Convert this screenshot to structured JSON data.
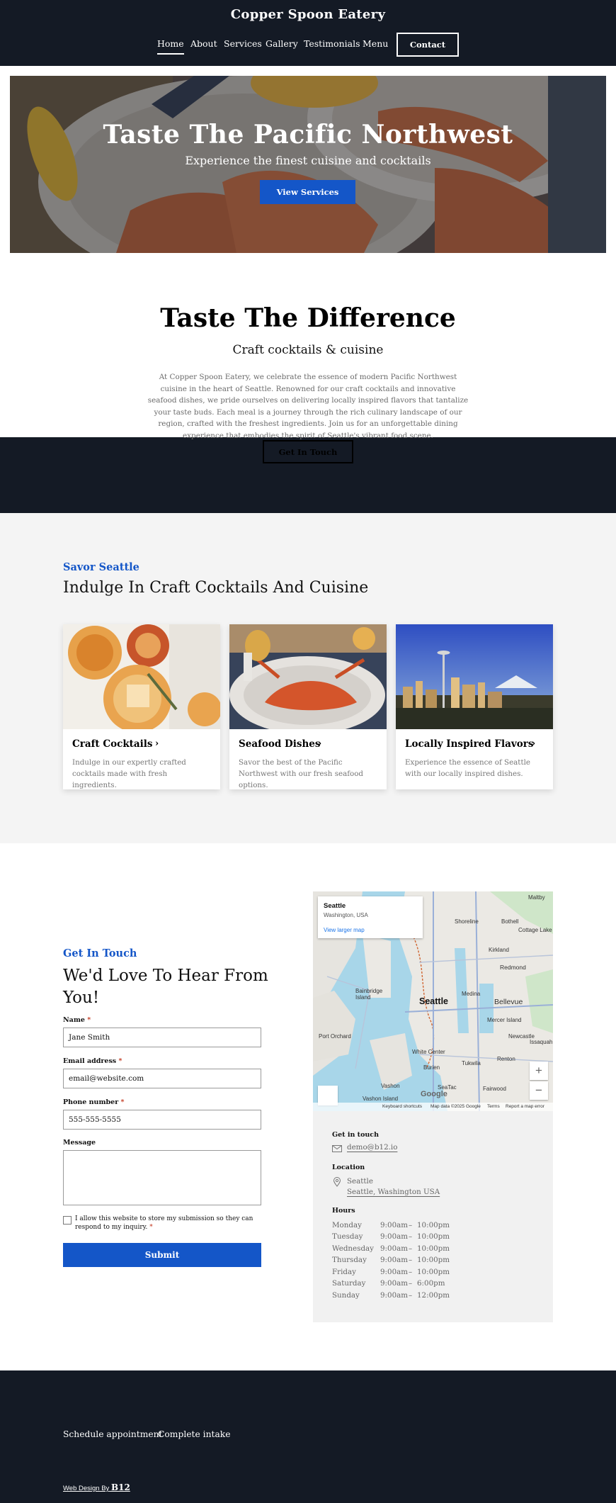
{
  "header": {
    "brand": "Copper Spoon Eatery",
    "nav": [
      "Home",
      "About",
      "Services",
      "Gallery",
      "Testimonials",
      "Menu"
    ],
    "active": "Home",
    "contact_label": "Contact"
  },
  "hero": {
    "title": "Taste The Pacific Northwest",
    "subtitle": "Experience the finest cuisine and cocktails",
    "button": "View Services"
  },
  "intro": {
    "title": "Taste The Difference",
    "subtitle": "Craft cocktails & cuisine",
    "body": "At Copper Spoon Eatery, we celebrate the essence of modern Pacific Northwest cuisine in the heart of Seattle. Renowned for our craft cocktails and innovative seafood dishes, we pride ourselves on delivering locally inspired flavors that tantalize your taste buds. Each meal is a journey through the rich culinary landscape of our region, crafted with the freshest ingredients. Join us for an unforgettable dining experience that embodies the spirit of Seattle's vibrant food scene.",
    "button": "Get In Touch"
  },
  "services": {
    "eyebrow": "Savor Seattle",
    "title": "Indulge In Craft Cocktails And Cuisine",
    "cards": [
      {
        "title": "Craft Cocktails",
        "text": "Indulge in our expertly crafted cocktails made with fresh ingredients."
      },
      {
        "title": "Seafood Dishes",
        "text": "Savor the best of the Pacific Northwest with our fresh seafood options."
      },
      {
        "title": "Locally Inspired Flavors",
        "text": "Experience the essence of Seattle with our locally inspired dishes."
      }
    ]
  },
  "contact": {
    "eyebrow": "Get In Touch",
    "title": "We'd Love To Hear From You!",
    "fields": {
      "name_label": "Name",
      "name_value": "Jane Smith",
      "email_label": "Email address",
      "email_value": "email@website.com",
      "phone_label": "Phone number",
      "phone_value": "555-555-5555",
      "message_label": "Message"
    },
    "required_mark": "*",
    "consent": "I allow this website to store my submission so they can respond to my inquiry.",
    "submit": "Submit"
  },
  "map": {
    "city": "Seattle",
    "region": "Washington, USA",
    "larger_map": "View larger map",
    "labels": [
      "Shoreline",
      "Bothell",
      "Cottage Lake",
      "Kirkland",
      "Redmond",
      "Bainbridge Island",
      "Seattle",
      "Medina",
      "Bellevue",
      "Mercer Island",
      "Port Orchard",
      "Newcastle",
      "White Center",
      "Burien",
      "Tukwila",
      "Renton",
      "Vashon",
      "SeaTac",
      "Fairwood",
      "Maltby",
      "Issaquah",
      "Vashon Island"
    ],
    "zoom_in": "+",
    "zoom_out": "−",
    "google": "Google",
    "footer": [
      "Keyboard shortcuts",
      "Map data ©2025 Google",
      "Terms",
      "Report a map error"
    ]
  },
  "info": {
    "get_in_touch_label": "Get in touch",
    "email": "demo@b12.io",
    "location_label": "Location",
    "location_line1": "Seattle",
    "location_line2": "Seattle, Washington USA",
    "hours_label": "Hours",
    "hours": [
      {
        "day": "Monday",
        "open": "9:00am",
        "close": "10:00pm"
      },
      {
        "day": "Tuesday",
        "open": "9:00am",
        "close": "10:00pm"
      },
      {
        "day": "Wednesday",
        "open": "9:00am",
        "close": "10:00pm"
      },
      {
        "day": "Thursday",
        "open": "9:00am",
        "close": "10:00pm"
      },
      {
        "day": "Friday",
        "open": "9:00am",
        "close": "10:00pm"
      },
      {
        "day": "Saturday",
        "open": "9:00am",
        "close": "6:00pm"
      },
      {
        "day": "Sunday",
        "open": "9:00am",
        "close": "12:00pm"
      }
    ],
    "dash": "–"
  },
  "footer": {
    "links": [
      "Schedule appointment",
      "Complete intake"
    ],
    "credit_prefix": "Web Design By",
    "credit_brand": "B12"
  },
  "colors": {
    "dark": "#141a25",
    "accent": "#1456c8",
    "light_bg": "#f4f4f4"
  }
}
